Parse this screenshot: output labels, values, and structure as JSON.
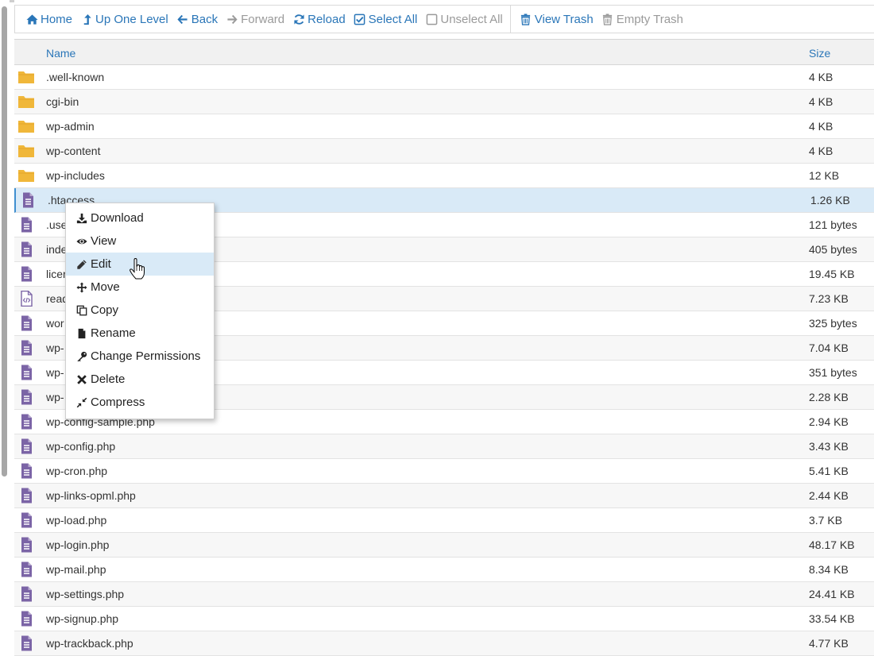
{
  "toolbar": {
    "home": "Home",
    "up": "Up One Level",
    "back": "Back",
    "forward": "Forward",
    "reload": "Reload",
    "select_all": "Select All",
    "unselect_all": "Unselect All",
    "view_trash": "View Trash",
    "empty_trash": "Empty Trash"
  },
  "table": {
    "col_name": "Name",
    "col_size": "Size",
    "rows": [
      {
        "name": ".well-known",
        "size": "4 KB",
        "type": "folder"
      },
      {
        "name": "cgi-bin",
        "size": "4 KB",
        "type": "folder"
      },
      {
        "name": "wp-admin",
        "size": "4 KB",
        "type": "folder"
      },
      {
        "name": "wp-content",
        "size": "4 KB",
        "type": "folder"
      },
      {
        "name": "wp-includes",
        "size": "12 KB",
        "type": "folder"
      },
      {
        "name": ".htaccess",
        "size": "1.26 KB",
        "type": "text"
      },
      {
        "name": ".use",
        "size": "121 bytes",
        "type": "text"
      },
      {
        "name": "inde",
        "size": "405 bytes",
        "type": "text"
      },
      {
        "name": "licer",
        "size": "19.45 KB",
        "type": "text"
      },
      {
        "name": "read",
        "size": "7.23 KB",
        "type": "code"
      },
      {
        "name": "wor",
        "size": "325 bytes",
        "type": "text"
      },
      {
        "name": "wp-",
        "size": "7.04 KB",
        "type": "text"
      },
      {
        "name": "wp-",
        "size": "351 bytes",
        "type": "text"
      },
      {
        "name": "wp-",
        "size": "2.28 KB",
        "type": "text"
      },
      {
        "name": "wp-config-sample.php",
        "size": "2.94 KB",
        "type": "text"
      },
      {
        "name": "wp-config.php",
        "size": "3.43 KB",
        "type": "text"
      },
      {
        "name": "wp-cron.php",
        "size": "5.41 KB",
        "type": "text"
      },
      {
        "name": "wp-links-opml.php",
        "size": "2.44 KB",
        "type": "text"
      },
      {
        "name": "wp-load.php",
        "size": "3.7 KB",
        "type": "text"
      },
      {
        "name": "wp-login.php",
        "size": "48.17 KB",
        "type": "text"
      },
      {
        "name": "wp-mail.php",
        "size": "8.34 KB",
        "type": "text"
      },
      {
        "name": "wp-settings.php",
        "size": "24.41 KB",
        "type": "text"
      },
      {
        "name": "wp-signup.php",
        "size": "33.54 KB",
        "type": "text"
      },
      {
        "name": "wp-trackback.php",
        "size": "4.77 KB",
        "type": "text"
      }
    ]
  },
  "context_menu": {
    "items": [
      {
        "label": "Download",
        "icon": "download-icon"
      },
      {
        "label": "View",
        "icon": "eye-icon"
      },
      {
        "label": "Edit",
        "icon": "pencil-icon"
      },
      {
        "label": "Move",
        "icon": "move-icon"
      },
      {
        "label": "Copy",
        "icon": "copy-icon"
      },
      {
        "label": "Rename",
        "icon": "file-icon"
      },
      {
        "label": "Change Permissions",
        "icon": "key-icon"
      },
      {
        "label": "Delete",
        "icon": "delete-icon"
      },
      {
        "label": "Compress",
        "icon": "compress-icon"
      }
    ]
  },
  "colors": {
    "link": "#2a76b8",
    "folder": "#f0b73a",
    "file": "#7b64a6",
    "selected_row": "#d9eaf7"
  }
}
